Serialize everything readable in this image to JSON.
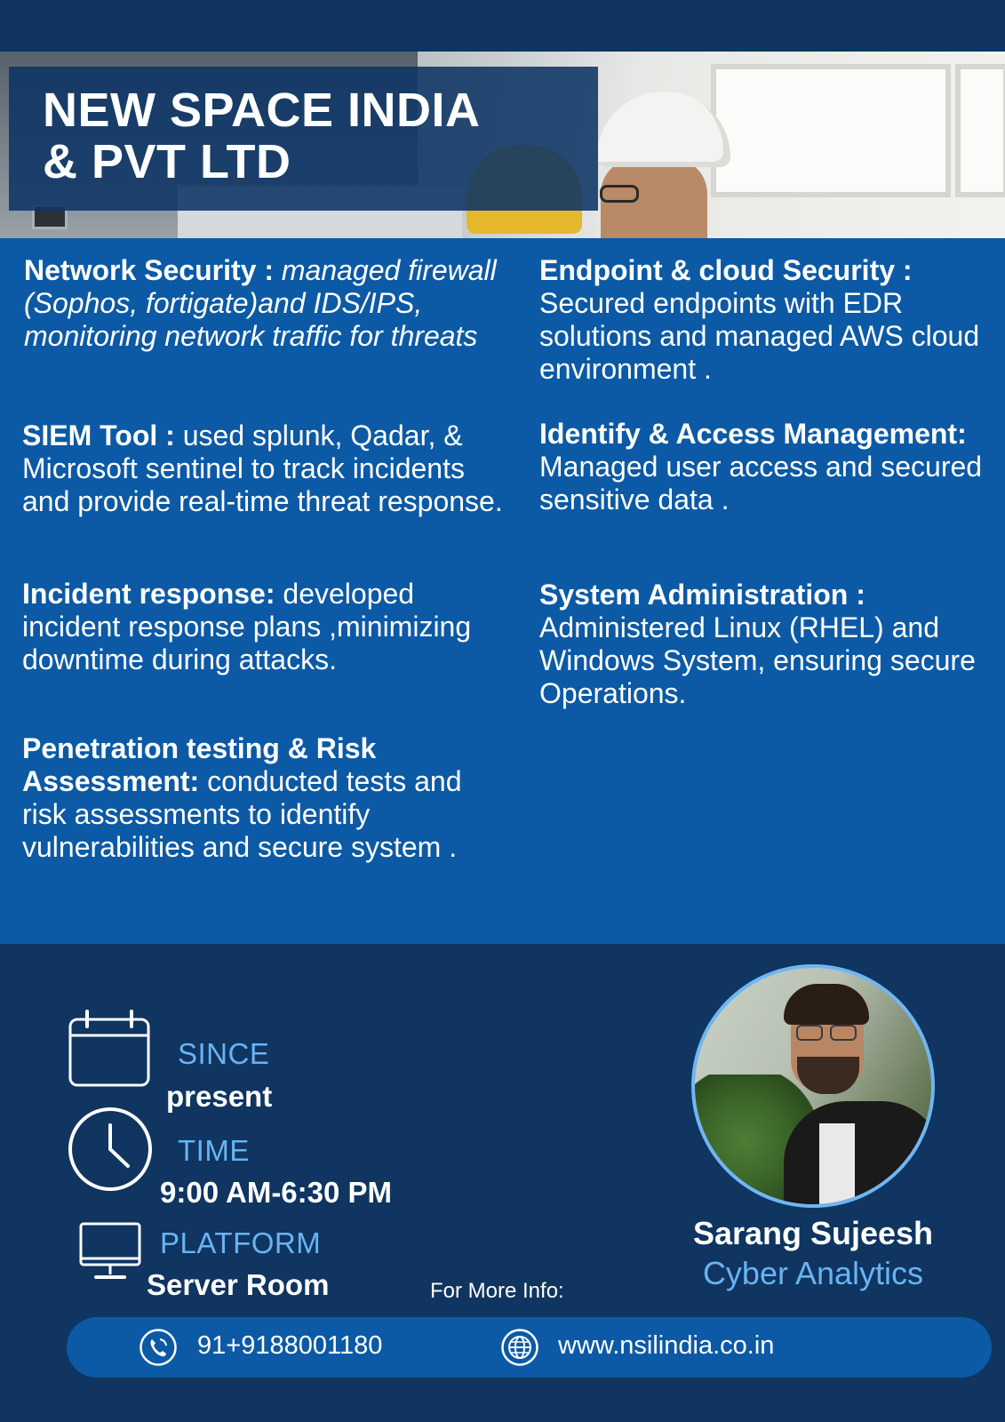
{
  "header": {
    "title_line1": "NEW SPACE INDIA",
    "title_line2": "& PVT LTD"
  },
  "left_column": [
    {
      "heading": "Network Security : ",
      "body": "managed firewall (Sophos, fortigate)and IDS/IPS, monitoring network traffic for threats"
    },
    {
      "heading": "SIEM Tool : ",
      "body": "used splunk, Qadar, & Microsoft sentinel to track incidents and provide real-time threat response."
    },
    {
      "heading": "Incident response: ",
      "body": "developed incident response plans ,minimizing downtime during attacks."
    },
    {
      "heading": "Penetration testing & Risk Assessment: ",
      "body": "conducted tests and risk assessments to identify vulnerabilities and secure system ."
    }
  ],
  "right_column": [
    {
      "heading": "Endpoint  & cloud Security : ",
      "body": "Secured endpoints with EDR solutions and managed AWS cloud environment ."
    },
    {
      "heading": "Identify & Access Management: ",
      "body": "Managed user access and secured sensitive data ."
    },
    {
      "heading": "System Administration : ",
      "body": "Administered Linux (RHEL) and Windows System, ensuring secure Operations."
    }
  ],
  "details": {
    "since_label": "SINCE",
    "since_value": "present",
    "time_label": "TIME",
    "time_value": "9:00 AM-6:30 PM",
    "platform_label": "PLATFORM",
    "platform_value": "Server Room"
  },
  "profile": {
    "name": "Sarang Sujeesh",
    "role": "Cyber Analytics"
  },
  "contact": {
    "more_info": "For More Info:",
    "phone": "91+9188001180",
    "website": "www.nsilindia.co.in"
  },
  "icons": {
    "calendar": "calendar-icon",
    "clock": "clock-icon",
    "monitor": "monitor-icon",
    "phone": "phone-icon",
    "globe": "globe-icon"
  },
  "colors": {
    "navy": "#0f3560",
    "blue": "#0c5aa6",
    "accent": "#69b3f4"
  }
}
